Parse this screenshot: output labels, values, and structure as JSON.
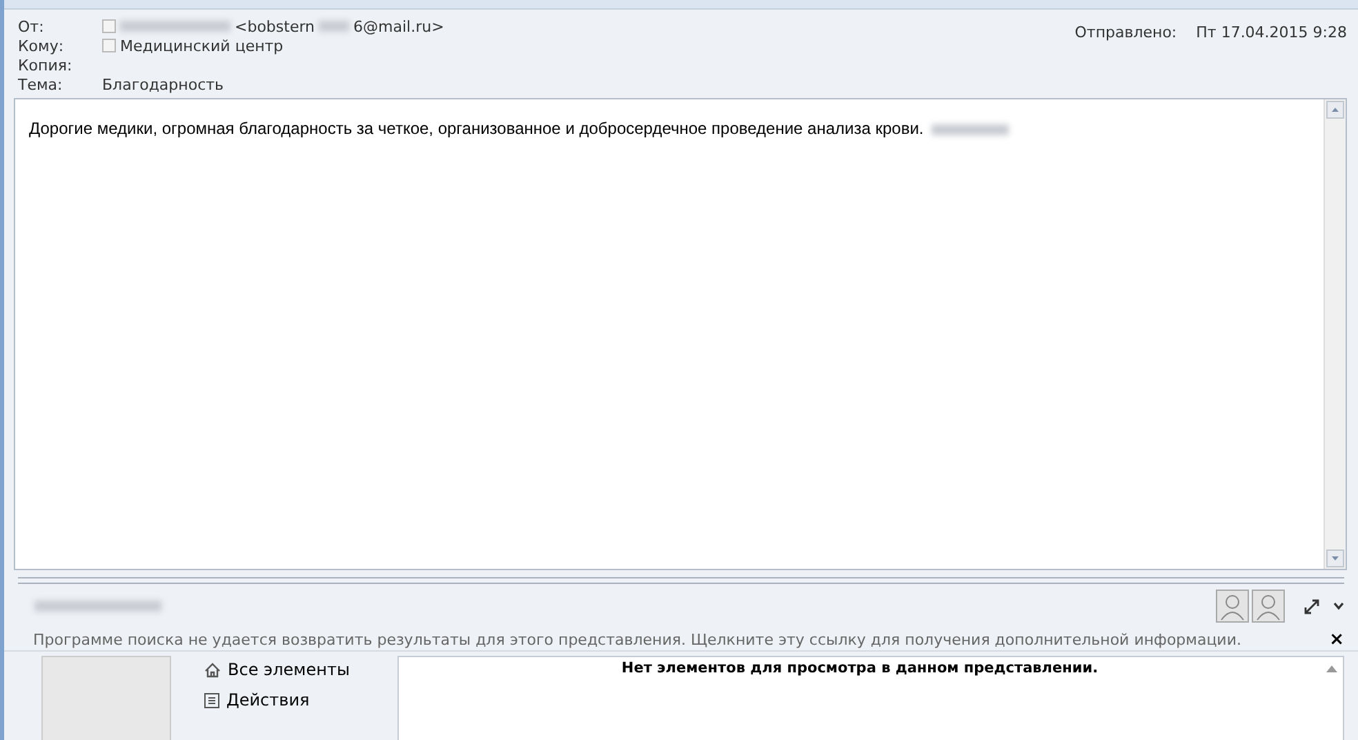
{
  "header": {
    "fields": [
      {
        "label": "От:",
        "kind": "sender",
        "value_start": "<bobstern",
        "value_end": "6@mail.ru>"
      },
      {
        "label": "Кому:",
        "kind": "contact",
        "value": "Медицинский центр"
      },
      {
        "label": "Копия:",
        "kind": "empty"
      },
      {
        "label": "Тема:",
        "kind": "text",
        "value": "Благодарность"
      }
    ],
    "sent_label": "Отправлено:",
    "sent_value": "Пт 17.04.2015 9:28"
  },
  "body": {
    "text": "Дорогие медики, огромная благодарность за четкое, организованное и добросердечное проведение анализа крови."
  },
  "people_pane": {
    "info": "Программе поиска не удается возвратить результаты для этого представления. Щелкните эту ссылку для получения дополнительной информации.",
    "nav": [
      {
        "label": "Все элементы",
        "kind": "home"
      },
      {
        "label": "Действия",
        "kind": "list"
      }
    ],
    "close_glyph": "×",
    "empty_message": "Нет элементов для просмотра в данном представлении."
  }
}
